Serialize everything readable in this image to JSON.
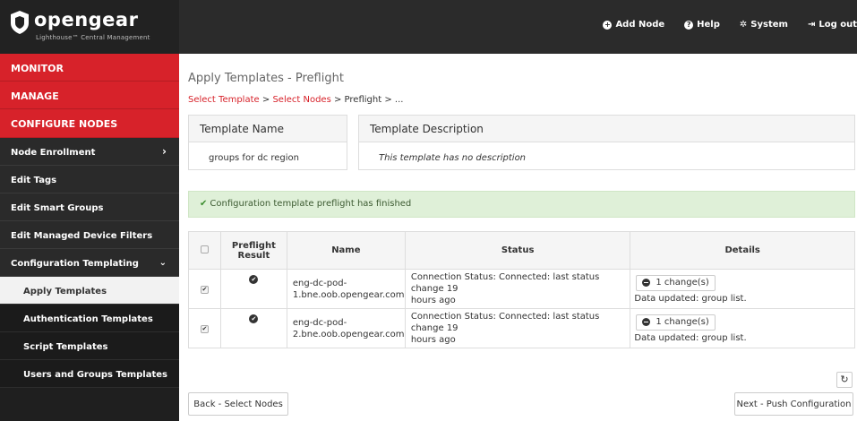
{
  "brand": {
    "name": "opengear",
    "subtitle": "Lighthouse™ Central Management"
  },
  "topnav": {
    "add_node": "Add Node",
    "help": "Help",
    "system": "System",
    "logout": "Log out"
  },
  "sidebar": {
    "monitor": "MONITOR",
    "manage": "MANAGE",
    "configure_nodes": "CONFIGURE NODES",
    "items": [
      {
        "label": "Node Enrollment"
      },
      {
        "label": "Edit Tags"
      },
      {
        "label": "Edit Smart Groups"
      },
      {
        "label": "Edit Managed Device Filters"
      },
      {
        "label": "Configuration Templating"
      }
    ],
    "sub_items": [
      {
        "label": "Apply Templates"
      },
      {
        "label": "Authentication Templates"
      },
      {
        "label": "Script Templates"
      },
      {
        "label": "Users and Groups Templates"
      }
    ]
  },
  "main": {
    "title": "Apply Templates - Preflight",
    "breadcrumb": {
      "step1": "Select Template",
      "sep": ">",
      "step2": "Select Nodes",
      "step3": "Preflight",
      "step4": "..."
    },
    "template_name_label": "Template Name",
    "template_name_value": "groups for dc region",
    "template_desc_label": "Template Description",
    "template_desc_value": "This template has no description",
    "alert": "Configuration template preflight has finished",
    "table": {
      "headers": {
        "preflight_line1": "Preflight",
        "preflight_line2": "Result",
        "name": "Name",
        "status": "Status",
        "details": "Details"
      },
      "rows": [
        {
          "name_line1": "eng-dc-pod-",
          "name_line2": "1.bne.oob.opengear.com",
          "status_line1": "Connection Status: Connected: last status change 19",
          "status_line2": "hours ago",
          "changes": "1 change(s)",
          "note": "Data updated: group list."
        },
        {
          "name_line1": "eng-dc-pod-",
          "name_line2": "2.bne.oob.opengear.com",
          "status_line1": "Connection Status: Connected: last status change 19",
          "status_line2": "hours ago",
          "changes": "1 change(s)",
          "note": "Data updated: group list."
        }
      ]
    },
    "back_button": "Back - Select Nodes",
    "next_button": "Next - Push Configuration"
  },
  "colors": {
    "brand_red": "#d7222a",
    "topbar": "#2b2b2b",
    "sidebar": "#1f1f1f",
    "success_bg": "#dff0d8"
  }
}
